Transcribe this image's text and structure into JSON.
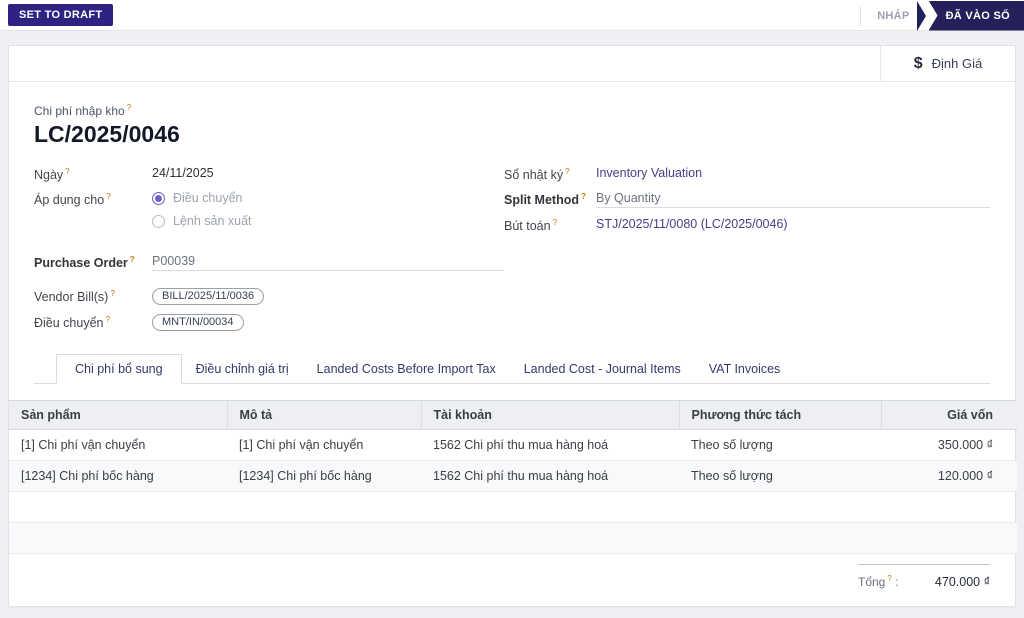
{
  "control_bar": {
    "set_to_draft_label": "SET TO DRAFT",
    "statusbar": {
      "draft_label": "NHÁP",
      "posted_label": "ĐÃ VÀO SỔ"
    }
  },
  "button_box": {
    "dollar_icon": "$",
    "valuation_label": "Định Giá"
  },
  "help_marker": "?",
  "header": {
    "field_label": "Chi phí nhập kho",
    "title": "LC/2025/0046"
  },
  "fields": {
    "date": {
      "label": "Ngày",
      "value": "24/11/2025"
    },
    "apply_on": {
      "label": "Áp dụng cho",
      "options": [
        {
          "label": "Điều chuyển",
          "selected": true
        },
        {
          "label": "Lệnh sản xuất",
          "selected": false
        }
      ]
    },
    "purchase_order": {
      "label": "Purchase Order",
      "value": "P00039"
    },
    "vendor_bills": {
      "label": "Vendor Bill(s)",
      "tag": "BILL/2025/11/0036"
    },
    "transfers": {
      "label": "Điều chuyển",
      "tag": "MNT/IN/00034"
    },
    "journal": {
      "label": "Sổ nhật ký",
      "value": "Inventory Valuation"
    },
    "split_method": {
      "label": "Split Method",
      "value": "By Quantity"
    },
    "journal_entry": {
      "label": "Bút toán",
      "value": "STJ/2025/11/0080 (LC/2025/0046)"
    }
  },
  "tabs": [
    {
      "label": "Chi phí bổ sung",
      "active": true
    },
    {
      "label": "Điều chỉnh giá trị",
      "active": false
    },
    {
      "label": "Landed Costs Before Import Tax",
      "active": false
    },
    {
      "label": "Landed Cost - Journal Items",
      "active": false
    },
    {
      "label": "VAT Invoices",
      "active": false
    }
  ],
  "table": {
    "columns": [
      "Sản phẩm",
      "Mô tả",
      "Tài khoản",
      "Phương thức tách",
      "Giá vốn"
    ],
    "rows": [
      {
        "product": "[1] Chi phí vận chuyển",
        "description": "[1] Chi phí vận chuyển",
        "account": "1562 Chi phí thu mua hàng hoá",
        "split_method": "Theo số lượng",
        "cost": "350.000 ₫"
      },
      {
        "product": "[1234] Chi phí bốc hàng",
        "description": "[1234] Chi phí bốc hàng",
        "account": "1562 Chi phí thu mua hàng hoá",
        "split_method": "Theo số lượng",
        "cost": "120.000 ₫"
      }
    ]
  },
  "total": {
    "label": "Tổng",
    "colon": ":",
    "value": "470.000 ₫"
  },
  "colors": {
    "primary_button": "#2e2382",
    "status_done_bg": "#24205a",
    "link": "#45408a",
    "table_header_bg": "#edeff3"
  }
}
